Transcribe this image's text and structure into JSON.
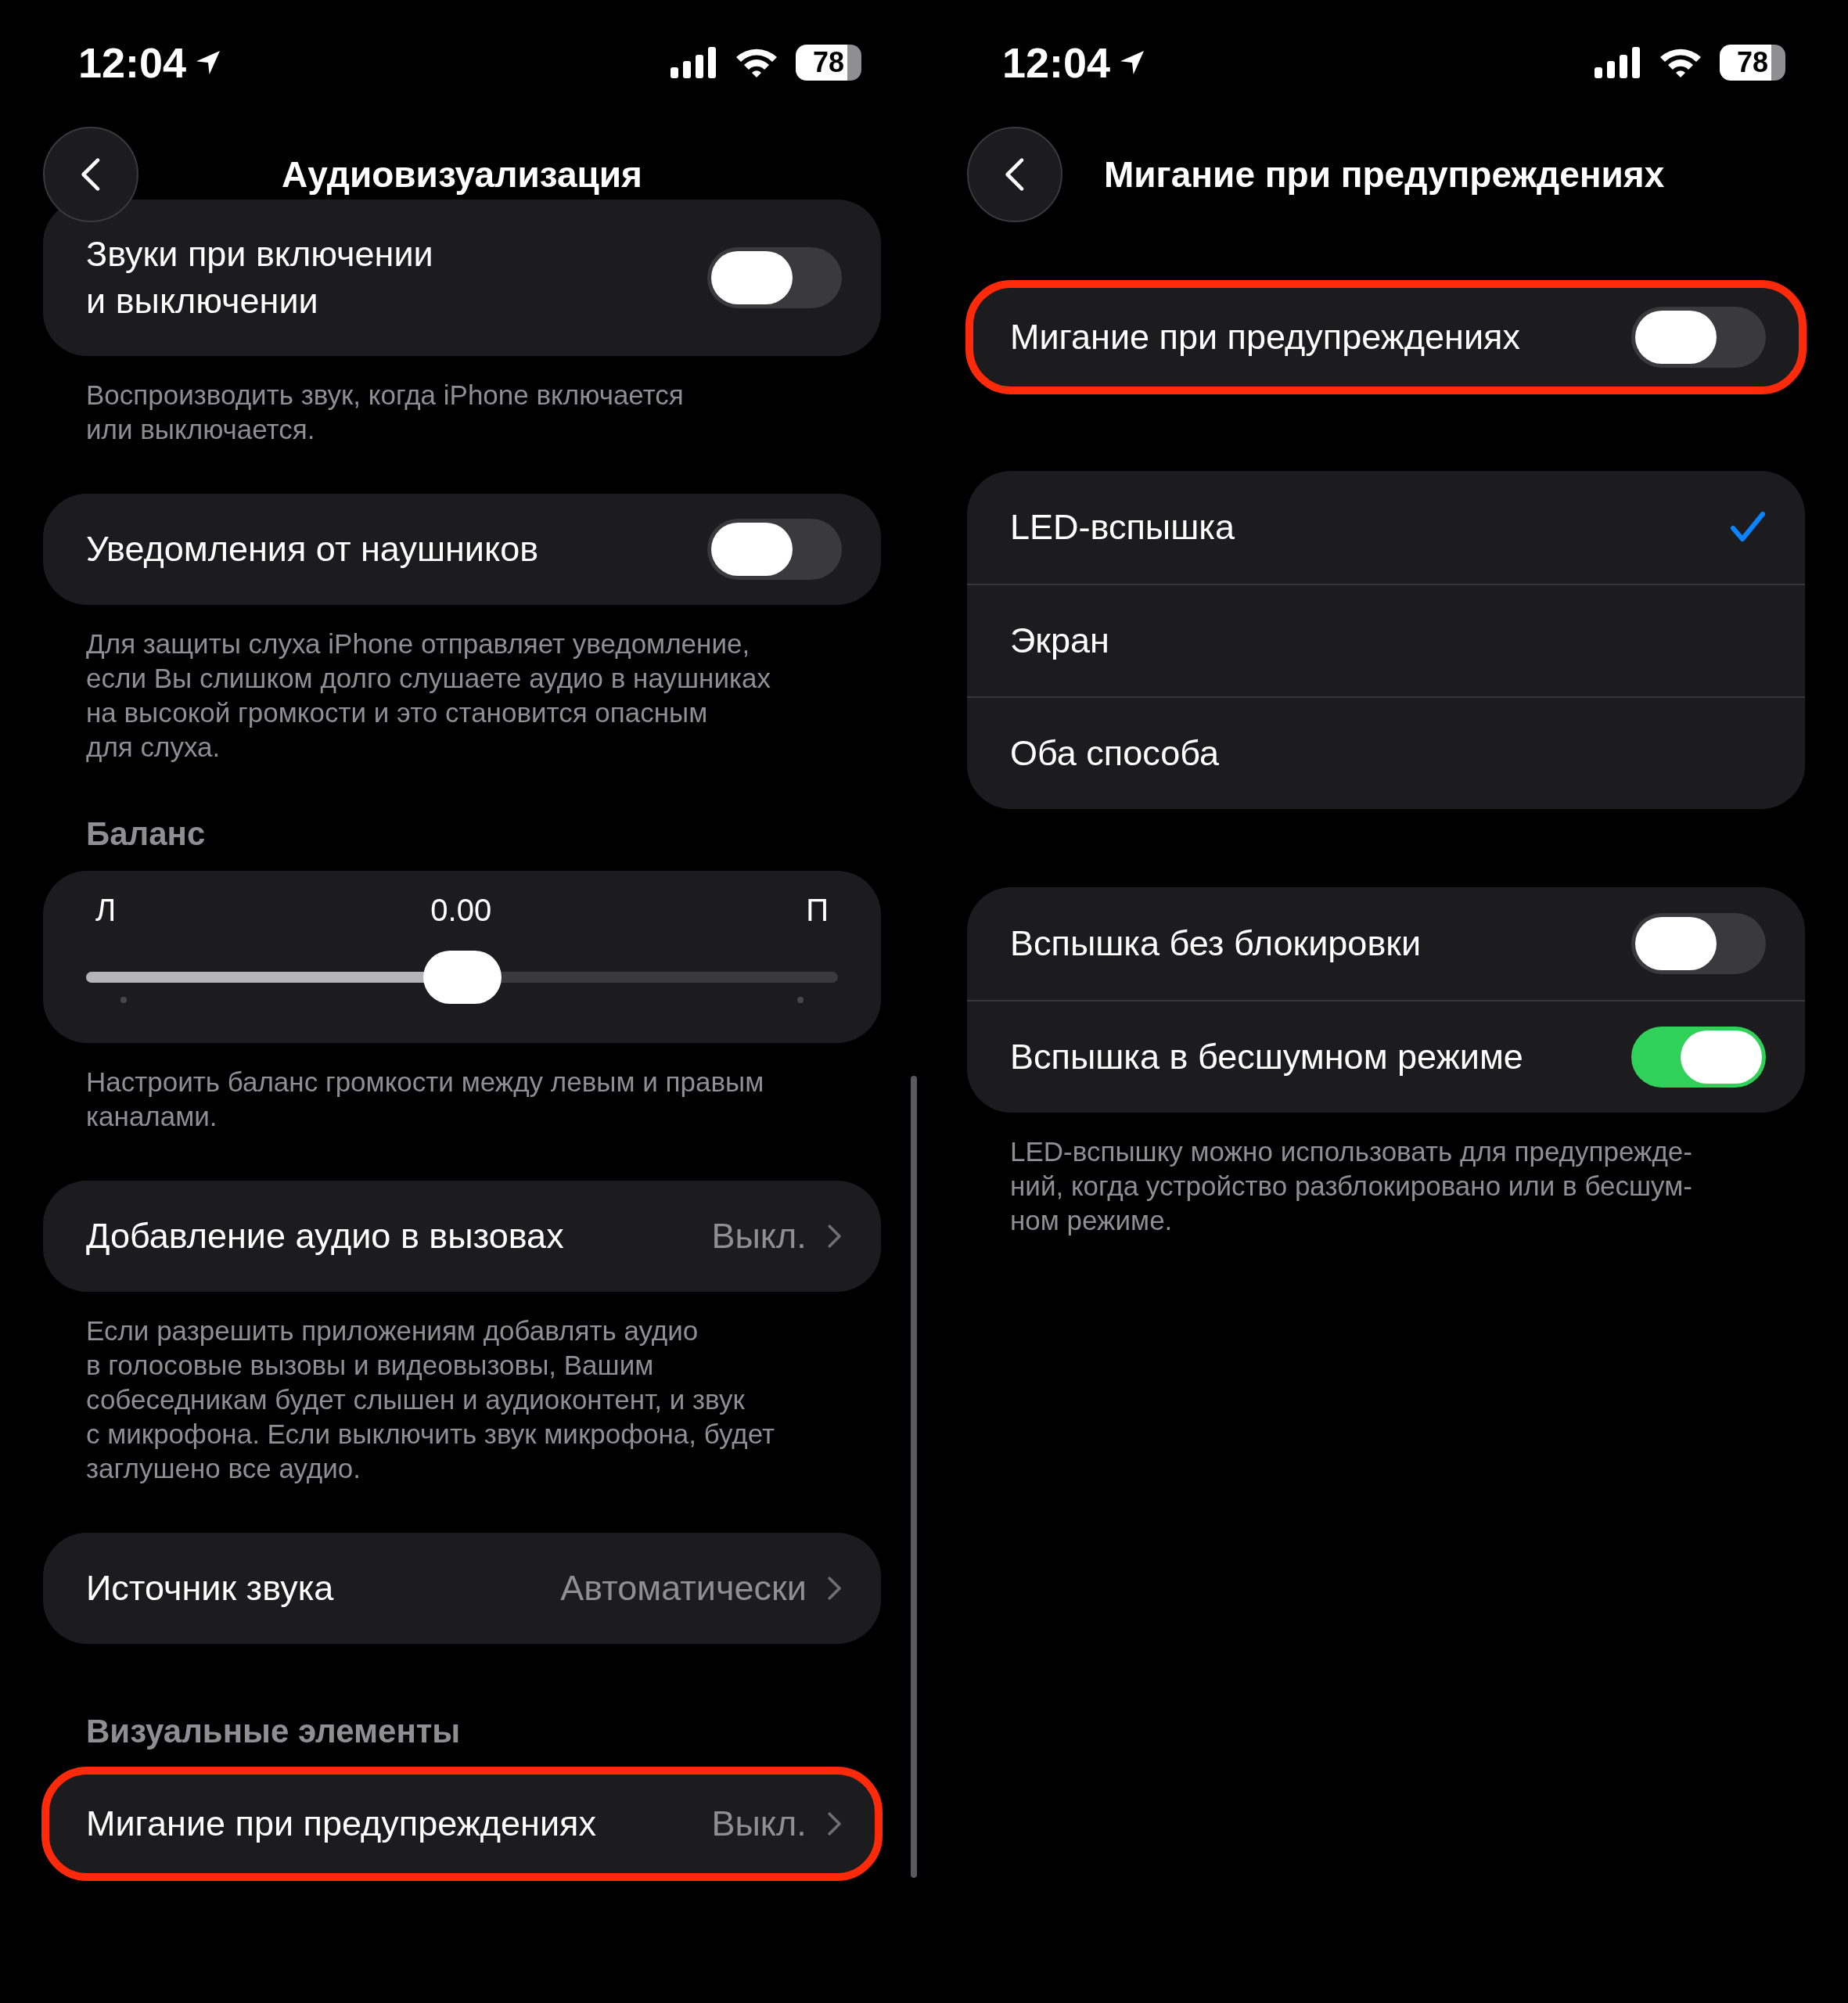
{
  "screens": [
    {
      "status_bar": {
        "time": "12:04",
        "battery": "78"
      },
      "nav": {
        "title": "Аудиовизуализация"
      },
      "sections": [
        {
          "kind": "group",
          "highlighted": false,
          "rows": [
            {
              "kind": "toggle",
              "label": "Звуки при включении\nи выключении",
              "on": false
            }
          ]
        },
        {
          "kind": "footnote",
          "text": "Воспроизводить звук, когда iPhone включается\nили выключается."
        },
        {
          "kind": "group",
          "highlighted": false,
          "rows": [
            {
              "kind": "toggle",
              "label": "Уведомления от наушников",
              "on": false
            }
          ]
        },
        {
          "kind": "footnote",
          "text": "Для защиты слуха iPhone отправляет уведомление,\nесли Вы слишком долго слушаете аудио в наушниках\nна высокой громкости и это становится опасным\nдля слуха."
        },
        {
          "kind": "header",
          "text": "Баланс"
        },
        {
          "kind": "slider",
          "left_label": "Л",
          "reading": "0.00",
          "right_label": "П",
          "level": 0.5
        },
        {
          "kind": "footnote",
          "text": "Настроить баланс громкости между левым и правым\nканалами."
        },
        {
          "kind": "group",
          "highlighted": false,
          "rows": [
            {
              "kind": "link",
              "label": "Добавление аудио в вызовах",
              "value": "Выкл."
            }
          ]
        },
        {
          "kind": "footnote",
          "text": "Если разрешить приложениям добавлять аудио\nв голосовые вызовы и видеовызовы, Вашим\nсобеседникам будет слышен и аудиоконтент, и звук\nс микрофона. Если выключить звук микрофона, будет\nзаглушено все аудио."
        },
        {
          "kind": "group",
          "highlighted": false,
          "rows": [
            {
              "kind": "link",
              "label": "Источник звука",
              "value": "Автоматически"
            }
          ]
        },
        {
          "kind": "header",
          "text": "Визуальные элементы"
        },
        {
          "kind": "group",
          "highlighted": true,
          "rows": [
            {
              "kind": "link",
              "label": "Мигание при предупреждениях",
              "value": "Выкл."
            }
          ]
        }
      ]
    },
    {
      "status_bar": {
        "time": "12:04",
        "battery": "78"
      },
      "nav": {
        "title": "Мигание при предупреждениях"
      },
      "sections": [
        {
          "kind": "group",
          "highlighted": true,
          "rows": [
            {
              "kind": "toggle",
              "label": "Мигание при предупреждениях",
              "on": false
            }
          ]
        },
        {
          "kind": "group",
          "highlighted": false,
          "rows": [
            {
              "kind": "option",
              "label": "LED-вспышка",
              "selected": true
            },
            {
              "kind": "option",
              "label": "Экран",
              "selected": false
            },
            {
              "kind": "option",
              "label": "Оба способа",
              "selected": false
            }
          ]
        },
        {
          "kind": "group",
          "highlighted": false,
          "rows": [
            {
              "kind": "toggle",
              "label": "Вспышка без блокировки",
              "on": false
            },
            {
              "kind": "toggle",
              "label": "Вспышка в бесшумном режиме",
              "on": true
            }
          ]
        },
        {
          "kind": "footnote",
          "text": "LED-вспышку можно использовать для предупрежде-\nний, когда устройство разблокировано или в бесшум-\nном режиме."
        }
      ]
    }
  ]
}
